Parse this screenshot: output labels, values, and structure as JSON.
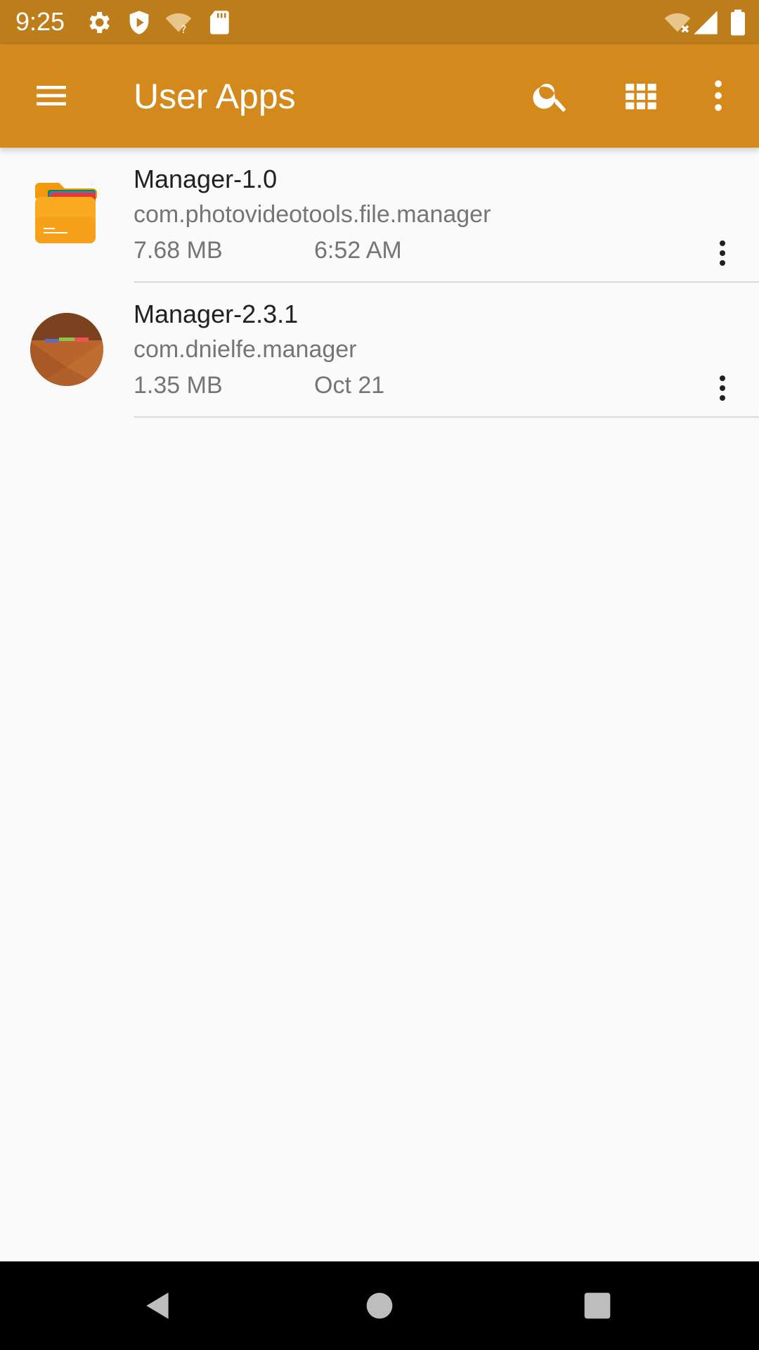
{
  "status_bar": {
    "time": "9:25",
    "icons": [
      "settings-icon",
      "shield-play-icon",
      "wifi-question-icon",
      "sd-card-icon",
      "wifi-off-icon",
      "signal-icon",
      "battery-icon"
    ],
    "bg_color": "#bd7d1b"
  },
  "app_bar": {
    "title": "User Apps",
    "actions": [
      "menu-icon",
      "search-icon",
      "grid-view-icon",
      "more-vert-icon"
    ],
    "bg_color": "#d4891c"
  },
  "apps": [
    {
      "name": "Manager-1.0",
      "package": "com.photovideotools.file.manager",
      "size": "7.68 MB",
      "date": "6:52 AM",
      "icon": "folder-app-icon"
    },
    {
      "name": "Manager-2.3.1",
      "package": "com.dnielfe.manager",
      "size": "1.35 MB",
      "date": "Oct 21",
      "icon": "round-brown-app-icon"
    }
  ],
  "nav_bar": {
    "buttons": [
      "back-icon",
      "home-icon",
      "recents-icon"
    ]
  }
}
